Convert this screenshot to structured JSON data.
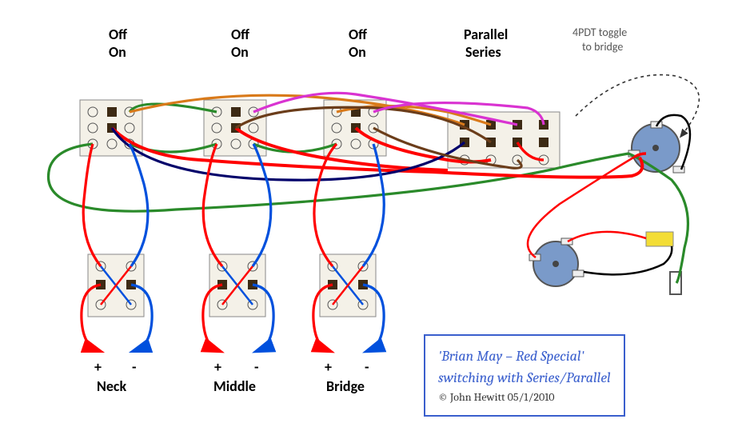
{
  "switches": {
    "top": [
      {
        "labels": {
          "off": "Off",
          "on": "On"
        }
      },
      {
        "labels": {
          "off": "Off",
          "on": "On"
        }
      },
      {
        "labels": {
          "off": "Off",
          "on": "On"
        }
      },
      {
        "labels": {
          "parallel": "Parallel",
          "series": "Series"
        }
      }
    ],
    "bottom_labels": [
      "Neck",
      "Middle",
      "Bridge"
    ]
  },
  "note": {
    "line1": "4PDT toggle",
    "line2": "to bridge"
  },
  "pickup_polarity": {
    "pos": "+",
    "neg": "-"
  },
  "caption": {
    "line1": "'Brian May – Red Special'",
    "line2": "switching with Series/Parallel",
    "credit": "© John Hewitt 05/1/2010"
  },
  "wire_colors": {
    "hot": "#ff0000",
    "ground": "#2a8a2a",
    "blue": "#0050dd",
    "navy": "#00006a",
    "orange": "#d97a1a",
    "brown": "#6b3d1a",
    "magenta": "#d933d1",
    "black": "#000"
  }
}
